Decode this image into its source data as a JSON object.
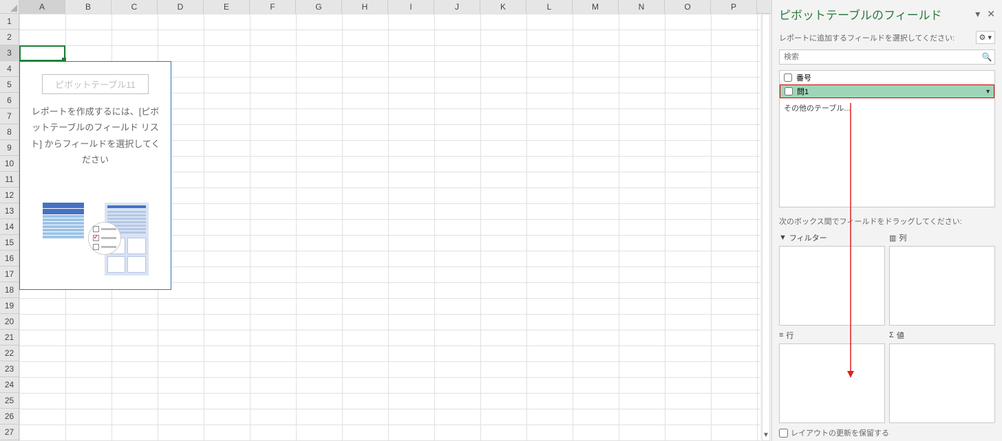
{
  "columns": [
    "A",
    "B",
    "C",
    "D",
    "E",
    "F",
    "G",
    "H",
    "I",
    "J",
    "K",
    "L",
    "M",
    "N",
    "O",
    "P"
  ],
  "rows_count": 27,
  "selected_col": 0,
  "selected_row": 2,
  "pivot": {
    "title": "ピボットテーブル11",
    "message": "レポートを作成するには、[ピボットテーブルのフィールド リスト] からフィールドを選択してください"
  },
  "panel": {
    "title": "ピボットテーブルのフィールド",
    "subtitle": "レポートに追加するフィールドを選択してください:",
    "search_placeholder": "検索",
    "fields": [
      {
        "name": "番号",
        "checked": false,
        "highlight": false
      },
      {
        "name": "問1",
        "checked": false,
        "highlight": true
      }
    ],
    "more_tables": "その他のテーブル...",
    "drag_message": "次のボックス間でフィールドをドラッグしてください:",
    "zones": {
      "filter": "フィルター",
      "columns": "列",
      "rows": "行",
      "values": "値"
    },
    "defer_label": "レイアウトの更新を保留する"
  }
}
